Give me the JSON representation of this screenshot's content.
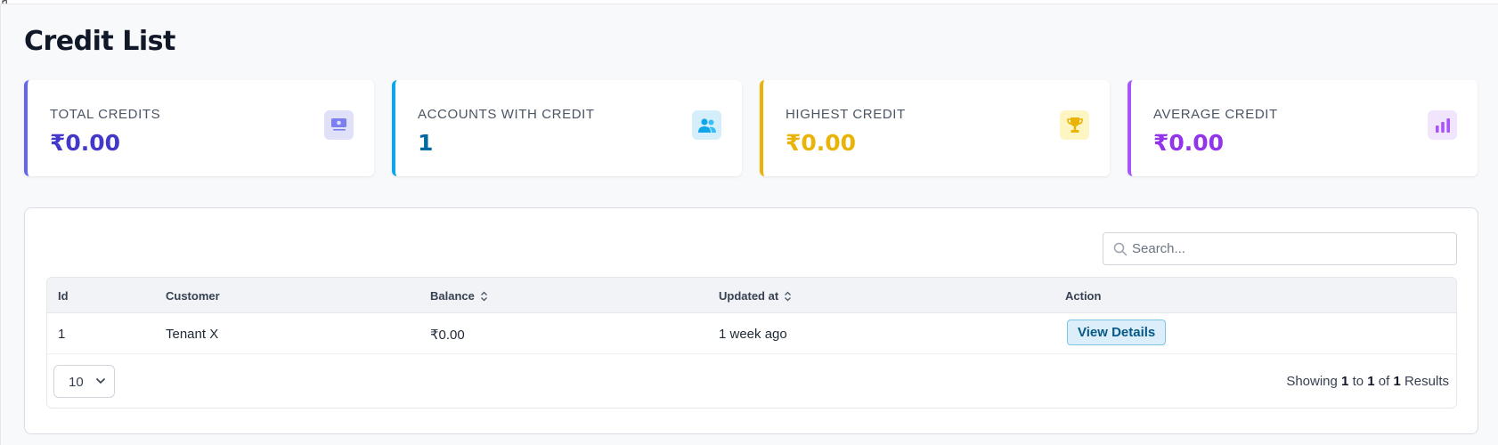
{
  "page": {
    "title": "Credit List"
  },
  "cards": [
    {
      "label": "TOTAL CREDITS",
      "value": "₹0.00",
      "icon": "money-icon",
      "accent": "#6366f1",
      "value_color": "#4338ca",
      "icon_bg": "#e0e0f8",
      "icon_color": "#6366f1"
    },
    {
      "label": "ACCOUNTS WITH CREDIT",
      "value": "1",
      "icon": "users-icon",
      "accent": "#0ea5e9",
      "value_color": "#0369a1",
      "icon_bg": "#d4effb",
      "icon_color": "#0ea5e9"
    },
    {
      "label": "HIGHEST CREDIT",
      "value": "₹0.00",
      "icon": "trophy-icon",
      "accent": "#eab308",
      "value_color": "#eab308",
      "icon_bg": "#fdf5c2",
      "icon_color": "#eab308"
    },
    {
      "label": "AVERAGE CREDIT",
      "value": "₹0.00",
      "icon": "bar-chart-icon",
      "accent": "#a855f7",
      "value_color": "#9333ea",
      "icon_bg": "#f1e5fd",
      "icon_color": "#a855f7"
    }
  ],
  "search": {
    "placeholder": "Search..."
  },
  "table": {
    "columns": [
      {
        "label": "Id",
        "sortable": false
      },
      {
        "label": "Customer",
        "sortable": false
      },
      {
        "label": "Balance",
        "sortable": true
      },
      {
        "label": "Updated at",
        "sortable": true
      },
      {
        "label": "Action",
        "sortable": false
      }
    ],
    "rows": [
      {
        "id": "1",
        "customer": "Tenant X",
        "balance": "₹0.00",
        "updated_at": "1 week ago",
        "action": "View Details"
      }
    ]
  },
  "pagination": {
    "page_size": "10",
    "showing_prefix": "Showing",
    "from": "1",
    "to_word": "to",
    "to": "1",
    "of_word": "of",
    "total": "1",
    "suffix": "Results"
  }
}
